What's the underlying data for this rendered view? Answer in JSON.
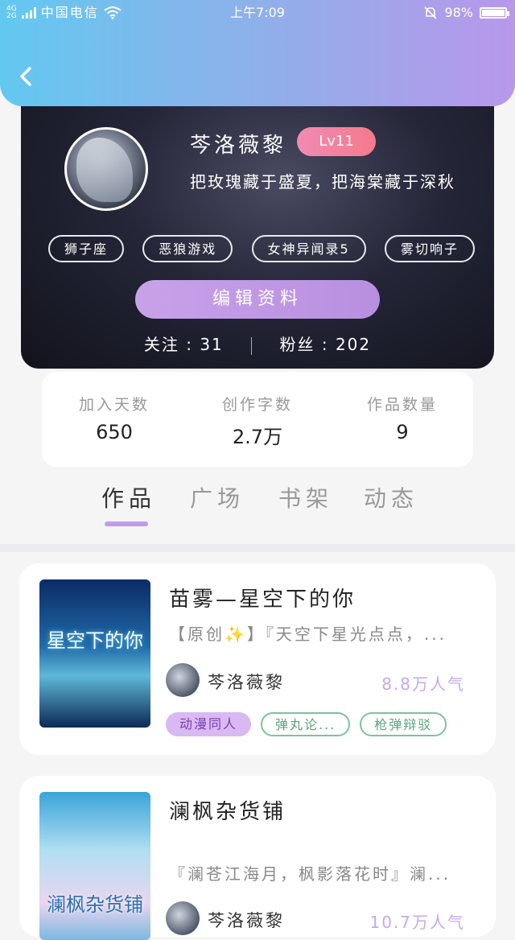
{
  "status_bar": {
    "network": "4G\n2G",
    "carrier": "中国电信",
    "time": "上午7:09",
    "battery": "98%",
    "battery_level": 0.98
  },
  "profile": {
    "username": "芩洛薇黎",
    "level": "Lv11",
    "bio": "把玫瑰藏于盛夏，把海棠藏于深秋",
    "tags": [
      "狮子座",
      "恶狼游戏",
      "女神异闻录5",
      "雾切响子"
    ],
    "edit_label": "编辑资料",
    "following_label": "关注",
    "following_count": "31",
    "followers_label": "粉丝",
    "followers_count": "202"
  },
  "stats": [
    {
      "label": "加入天数",
      "value": "650"
    },
    {
      "label": "创作字数",
      "value": "2.7万"
    },
    {
      "label": "作品数量",
      "value": "9"
    }
  ],
  "tabs": [
    {
      "label": "作品",
      "active": true
    },
    {
      "label": "广场",
      "active": false
    },
    {
      "label": "书架",
      "active": false
    },
    {
      "label": "动态",
      "active": false
    }
  ],
  "works": [
    {
      "title": "苗雾—星空下的你",
      "cover_text": "星空下的你",
      "description": "【原创✨】『天空下星光点点，...",
      "author": "芩洛薇黎",
      "popularity": "8.8万人气",
      "tags": [
        "动漫同人",
        "弹丸论...",
        "枪弹辩驳"
      ]
    },
    {
      "title": "澜枫杂货铺",
      "cover_text": "澜枫杂货铺",
      "description": "『澜苍江海月，枫影落花时』澜...",
      "author": "芩洛薇黎",
      "popularity": "10.7万人气"
    }
  ],
  "colors": {
    "accent": "#c39be8",
    "header_gradient_start": "#62c8f0",
    "header_gradient_end": "#b897ea",
    "tag_green": "#7cc49a"
  }
}
